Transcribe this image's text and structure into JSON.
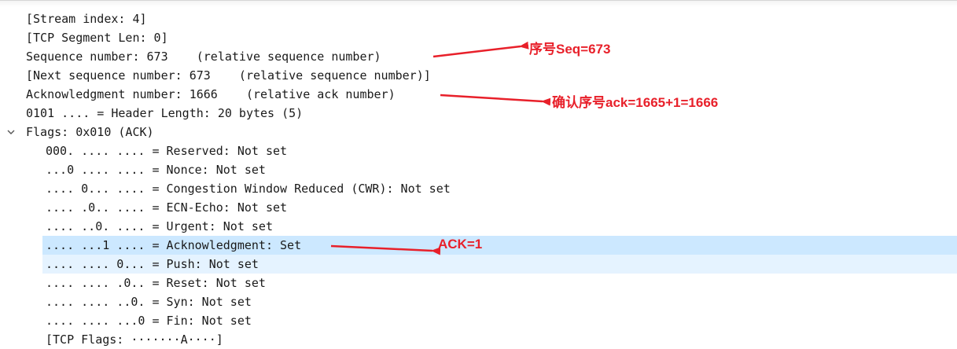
{
  "tree": {
    "rows": [
      {
        "text": "[Stream index: 4]"
      },
      {
        "text": "[TCP Segment Len: 0]"
      },
      {
        "text": "Sequence number: 673    (relative sequence number)"
      },
      {
        "text": "[Next sequence number: 673    (relative sequence number)]"
      },
      {
        "text": "Acknowledgment number: 1666    (relative ack number)"
      },
      {
        "text": "0101 .... = Header Length: 20 bytes (5)"
      },
      {
        "text": "Flags: 0x010 (ACK)"
      }
    ],
    "flags": [
      {
        "text": "000. .... .... = Reserved: Not set"
      },
      {
        "text": "...0 .... .... = Nonce: Not set"
      },
      {
        "text": ".... 0... .... = Congestion Window Reduced (CWR): Not set"
      },
      {
        "text": ".... .0.. .... = ECN-Echo: Not set"
      },
      {
        "text": ".... ..0. .... = Urgent: Not set"
      },
      {
        "text": ".... ...1 .... = Acknowledgment: Set"
      },
      {
        "text": ".... .... 0... = Push: Not set"
      },
      {
        "text": ".... .... .0.. = Reset: Not set"
      },
      {
        "text": ".... .... ..0. = Syn: Not set"
      },
      {
        "text": ".... .... ...0 = Fin: Not set"
      },
      {
        "text": "[TCP Flags: ·······A····]"
      }
    ]
  },
  "annotations": {
    "seq": "序号Seq=673",
    "ack": "确认序号ack=1665+1=1666",
    "ack_flag": "ACK=1",
    "color": "#e8202a"
  }
}
